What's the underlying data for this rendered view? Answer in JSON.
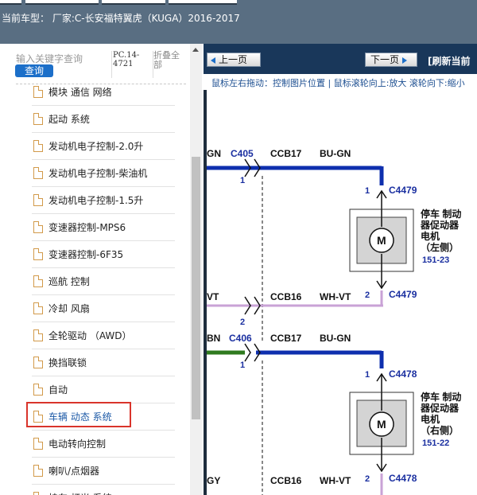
{
  "header": {
    "car_model_label": "当前车型：  厂家:C-长安福特翼虎（KUGA）2016-2017"
  },
  "search": {
    "placeholder": "输入关键字查询",
    "query_button": "查询",
    "code": "PC.14-4721",
    "collapse_all": "折叠全部"
  },
  "tree": {
    "items": [
      {
        "label": "模块 通信 网络"
      },
      {
        "label": "起动 系统"
      },
      {
        "label": "发动机电子控制-2.0升"
      },
      {
        "label": "发动机电子控制-柴油机"
      },
      {
        "label": "发动机电子控制-1.5升"
      },
      {
        "label": "变速器控制-MPS6"
      },
      {
        "label": "变速器控制-6F35"
      },
      {
        "label": "巡航 控制"
      },
      {
        "label": "冷却 风扇"
      },
      {
        "label": "全轮驱动 （AWD）"
      },
      {
        "label": "换挡联锁"
      },
      {
        "label": "自动"
      },
      {
        "label": "车辆 动态 系统",
        "selected": true
      },
      {
        "label": "电动转向控制"
      },
      {
        "label": "喇叭/点烟器"
      },
      {
        "label": "挂车 灯光 系统"
      }
    ]
  },
  "viewer": {
    "prev_button": "上一页",
    "next_button": "下一页",
    "refresh": "[刷新当前",
    "hint": "鼠标左右拖动：控制图片位置 | 鼠标滚轮向上:放大  滚轮向下:缩小"
  },
  "diagram": {
    "top": {
      "wire1_color": "GN",
      "conn_left": "C405",
      "pin_left": "1",
      "circuit1": "CCB17",
      "color1": "BU-GN",
      "pin_a": "1",
      "conn_a": "C4479",
      "wire2_color": "VT",
      "pin_left2": "2",
      "circuit2": "CCB16",
      "color2": "WH-VT",
      "pin_b": "2",
      "conn_b": "C4479",
      "motor_label": "M",
      "title_line1": "停车 制动",
      "title_line2": "器促动器",
      "title_line3": "电机",
      "side": "（左侧）",
      "ref": "151-23"
    },
    "bottom": {
      "wire1_color": "BN",
      "conn_left": "C406",
      "pin_left": "1",
      "circuit1": "CCB17",
      "color1": "BU-GN",
      "pin_a": "1",
      "conn_a": "C4478",
      "wire2_color": "GY",
      "pin_left2": "2",
      "circuit2": "CCB16",
      "color2": "WH-VT",
      "pin_b": "2",
      "conn_b": "C4478",
      "motor_label": "M",
      "title_line1": "停车 制动",
      "title_line2": "器促动器",
      "title_line3": "电机",
      "side": "（右侧）",
      "ref": "151-22"
    }
  },
  "colors": {
    "topbar": "#596e82",
    "accent": "#1c6fc9",
    "highlight": "#d9342b",
    "wire_blue": "#0e2fae",
    "wire_violet": "#c9a2d6",
    "wire_green": "#2f7a1f",
    "motor_fill": "#d4d4d4",
    "nav_bg": "#19375a"
  },
  "icons": {
    "tree_item": "document-icon",
    "prev": "arrow-left-icon",
    "next": "arrow-right-icon",
    "scroll_up": "arrow-up-icon",
    "motor": "motor-icon"
  }
}
